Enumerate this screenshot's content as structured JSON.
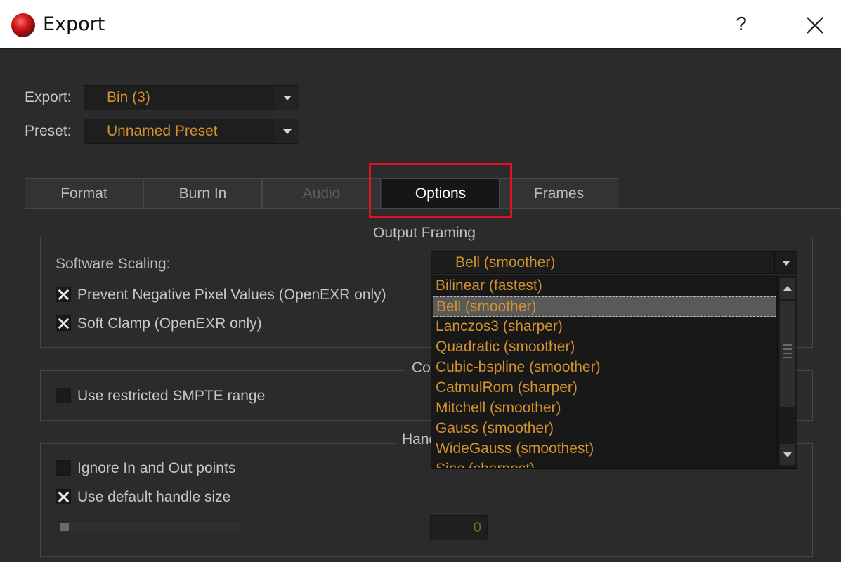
{
  "window": {
    "title": "Export",
    "help_label": "?",
    "icons": {
      "app": "red-orb-app-icon",
      "close": "close-icon"
    }
  },
  "header": {
    "export_label": "Export:",
    "export_value": "Bin (3)",
    "preset_label": "Preset:",
    "preset_value": "Unnamed Preset"
  },
  "tabs": [
    {
      "label": "Format",
      "state": "normal"
    },
    {
      "label": "Burn In",
      "state": "normal"
    },
    {
      "label": "Audio",
      "state": "disabled"
    },
    {
      "label": "Options",
      "state": "active"
    },
    {
      "label": "Frames",
      "state": "normal"
    }
  ],
  "output_framing": {
    "title": "Output Framing",
    "software_scaling_label": "Software Scaling:",
    "prevent_negative": {
      "label": "Prevent Negative Pixel Values (OpenEXR only)",
      "checked": true
    },
    "soft_clamp": {
      "label": "Soft Clamp (OpenEXR only)",
      "checked": true
    }
  },
  "color_group": {
    "title_visible": "Co",
    "smpte": {
      "label": "Use restricted SMPTE range",
      "checked": false
    }
  },
  "handles_group": {
    "title_visible": "Hand",
    "ignore_in_out": {
      "label": "Ignore In and Out points",
      "checked": false
    },
    "default_handle": {
      "label": "Use default handle size",
      "checked": true
    },
    "handle_value": "0",
    "handle_slider_level": 0
  },
  "scaling_dropdown": {
    "selected": "Bell (smoother)",
    "options": [
      "Bilinear (fastest)",
      "Bell (smoother)",
      "Lanczos3 (sharper)",
      "Quadratic (smoother)",
      "Cubic-bspline (smoother)",
      "CatmulRom (sharper)",
      "Mitchell (smoother)",
      "Gauss (smoother)",
      "WideGauss (smoothest)",
      "Sinc (sharpest)"
    ],
    "highlighted_index": 1
  },
  "colors": {
    "accent_text": "#d2922c",
    "background": "#2b2b2b",
    "annotation_box": "#e0141e"
  }
}
